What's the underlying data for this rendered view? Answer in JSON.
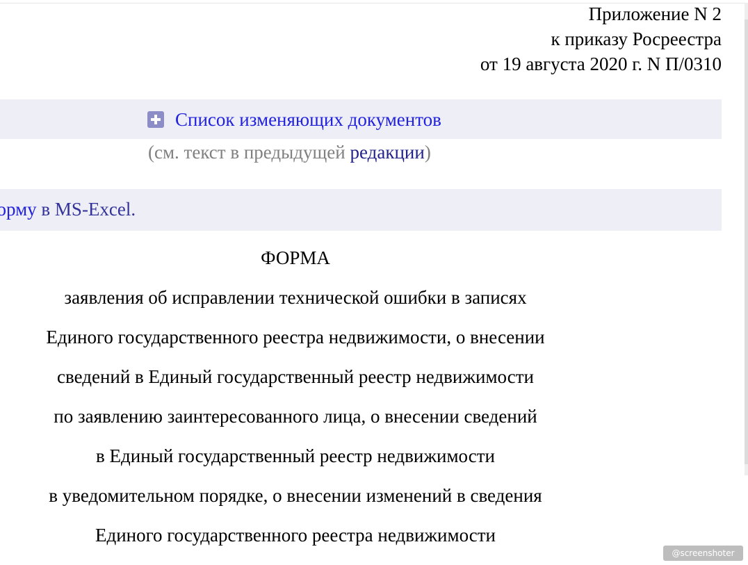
{
  "header": {
    "appendix_line1": "Приложение N 2",
    "appendix_line2": "к приказу Росреестра",
    "appendix_line3": "от 19 августа 2020 г. N П/0310"
  },
  "changes": {
    "icon": "plus-box-icon",
    "link_label": "Список изменяющих документов",
    "prev_open": "(см. текст в предыдущей ",
    "prev_link": "редакции",
    "prev_close": ")"
  },
  "excel": {
    "link_label": "форму",
    "text_rest": " в MS-Excel."
  },
  "form": {
    "title": "ФОРМА",
    "lines": [
      "заявления об исправлении технической ошибки в записях",
      "Единого государственного реестра недвижимости, о внесении",
      "сведений в Единый государственный реестр недвижимости",
      "по заявлению заинтересованного лица, о внесении сведений",
      "в Единый государственный реестр недвижимости",
      "в уведомительном порядке, о внесении изменений в сведения",
      "Единого государственного реестра недвижимости"
    ]
  },
  "watermark": {
    "label": "@screenshoter"
  },
  "colors": {
    "link": "#2222dd",
    "visited_link": "#22228a",
    "bar_background": "#eeeef6",
    "muted_text": "#808080"
  }
}
